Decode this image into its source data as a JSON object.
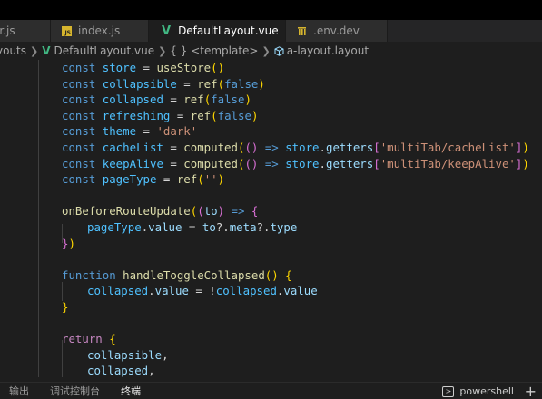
{
  "tabs": [
    {
      "label": "er.js",
      "icon": "none",
      "active": false
    },
    {
      "label": "index.js",
      "icon": "js-file-icon",
      "active": false
    },
    {
      "label": "DefaultLayout.vue",
      "icon": "vue-icon",
      "active": true,
      "close": "×"
    },
    {
      "label": ".env.dev",
      "icon": "env-file-icon",
      "active": false
    }
  ],
  "breadcrumbs": [
    "youts",
    "DefaultLayout.vue",
    "{ } <template>",
    "a-layout.layout"
  ],
  "code": {
    "l01": {
      "a": "const ",
      "b": "store",
      "c": " = ",
      "d": "useStore",
      "e": "()"
    },
    "l02": {
      "a": "const ",
      "b": "collapsible",
      "c": " = ",
      "d": "ref",
      "e": "(",
      "f": "false",
      "g": ")"
    },
    "l03": {
      "a": "const ",
      "b": "collapsed",
      "c": " = ",
      "d": "ref",
      "e": "(",
      "f": "false",
      "g": ")"
    },
    "l04": {
      "a": "const ",
      "b": "refreshing",
      "c": " = ",
      "d": "ref",
      "e": "(",
      "f": "false",
      "g": ")"
    },
    "l05": {
      "a": "const ",
      "b": "theme",
      "c": " = ",
      "d": "'dark'"
    },
    "l06": {
      "a": "const ",
      "b": "cacheList",
      "c": " = ",
      "d": "computed",
      "e": "(",
      "f": "()",
      "g": " => ",
      "h": "store",
      "i": ".",
      "j": "getters",
      "k": "[",
      "l": "'multiTab/cacheList'",
      "m": "]",
      "n": ")"
    },
    "l07": {
      "a": "const ",
      "b": "keepAlive",
      "c": " = ",
      "d": "computed",
      "e": "(",
      "f": "()",
      "g": " => ",
      "h": "store",
      "i": ".",
      "j": "getters",
      "k": "[",
      "l": "'multiTab/keepAlive'",
      "m": "]",
      "n": ")"
    },
    "l08": {
      "a": "const ",
      "b": "pageType",
      "c": " = ",
      "d": "ref",
      "e": "(",
      "f": "''",
      "g": ")"
    },
    "l09": {
      "a": "onBeforeRouteUpdate",
      "b": "(",
      "c": "(",
      "d": "to",
      "e": ")",
      "f": " => ",
      "g": "{"
    },
    "l10": {
      "a": "pageType",
      "b": ".",
      "c": "value",
      "d": " = ",
      "e": "to",
      "f": "?.",
      "g": "meta",
      "h": "?.",
      "i": "type"
    },
    "l11": {
      "a": "}",
      "b": ")"
    },
    "l12": {
      "a": "function ",
      "b": "handleToggleCollapsed",
      "c": "()",
      "d": " {"
    },
    "l13": {
      "a": "collapsed",
      "b": ".",
      "c": "value",
      "d": " = !",
      "e": "collapsed",
      "f": ".",
      "g": "value"
    },
    "l14": {
      "a": "}"
    },
    "l15": {
      "a": "return",
      "b": " {"
    },
    "l16": {
      "a": "collapsible",
      "b": ","
    },
    "l17": {
      "a": "collapsed",
      "b": ","
    }
  },
  "panel": {
    "tabs": [
      "输出",
      "调试控制台",
      "终端"
    ],
    "active_tab": "终端",
    "terminal_label": "powershell",
    "add_label": "+"
  }
}
